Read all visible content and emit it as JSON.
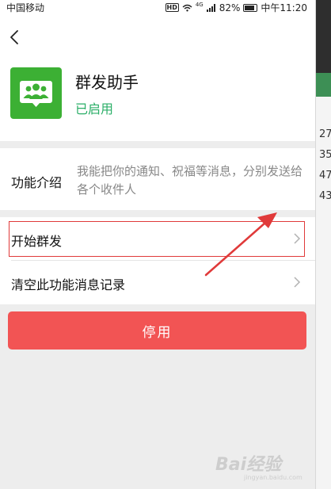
{
  "status_bar": {
    "carrier": "中国移动",
    "hd": "HD",
    "signal": "4G",
    "battery": "82%",
    "time": "中午11:20"
  },
  "header": {
    "back_icon": "chevron-left-icon",
    "app_name": "群发助手",
    "app_status": "已启用",
    "icon_color": "#3cb034"
  },
  "intro": {
    "label": "功能介绍",
    "text": "我能把你的通知、祝福等消息，分别发送给各个收件人"
  },
  "list": {
    "items": [
      {
        "label": "开始群发"
      },
      {
        "label": "清空此功能消息记录"
      }
    ]
  },
  "disable_button": {
    "label": "停用",
    "color": "#f25454"
  },
  "background_strip": {
    "numbers": [
      "27",
      "35",
      "47",
      "43"
    ]
  },
  "watermark": {
    "text": "Bai经验",
    "sub": "jingyan.baidu.com"
  }
}
